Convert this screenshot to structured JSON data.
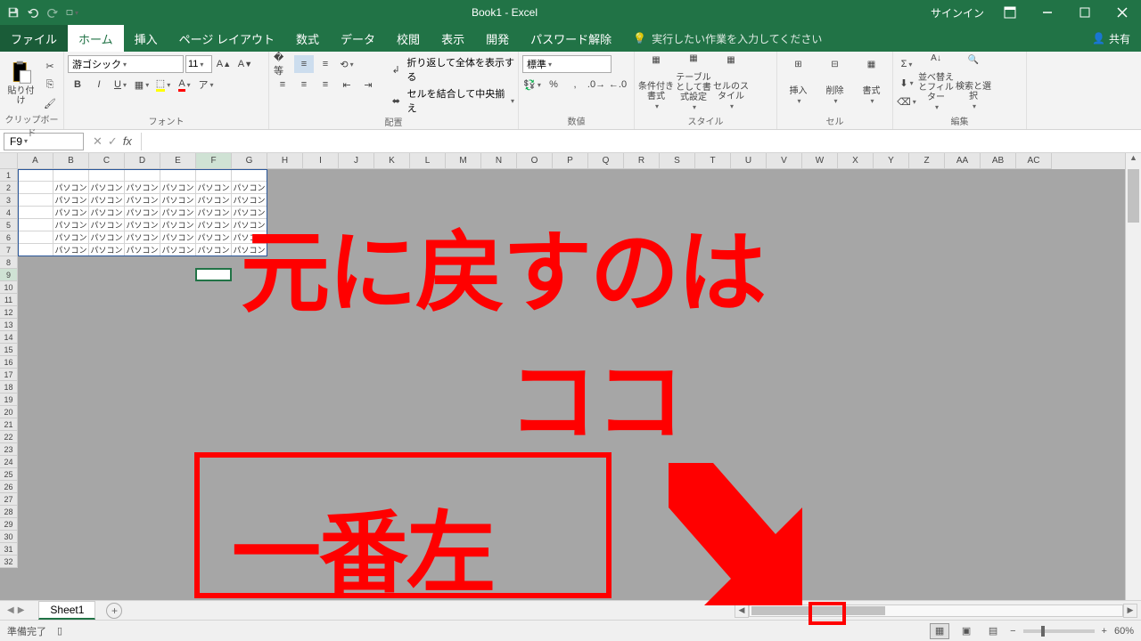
{
  "title": "Book1 - Excel",
  "signin": "サインイン",
  "share": "共有",
  "tabs": {
    "file": "ファイル",
    "home": "ホーム",
    "insert": "挿入",
    "layout": "ページ レイアウト",
    "formulas": "数式",
    "data": "データ",
    "review": "校閲",
    "view": "表示",
    "dev": "開発",
    "pwd": "パスワード解除"
  },
  "tellme": "実行したい作業を入力してください",
  "ribbon": {
    "clipboard": {
      "label": "クリップボード",
      "paste": "貼り付け"
    },
    "font": {
      "label": "フォント",
      "name": "游ゴシック",
      "size": "11"
    },
    "align": {
      "label": "配置",
      "wrap": "折り返して全体を表示する",
      "merge": "セルを結合して中央揃え"
    },
    "number": {
      "label": "数値",
      "format": "標準"
    },
    "styles": {
      "label": "スタイル",
      "cond": "条件付き書式",
      "table": "テーブルとして書式設定",
      "cell": "セルのスタイル"
    },
    "cells": {
      "label": "セル",
      "insert": "挿入",
      "delete": "削除",
      "format": "書式"
    },
    "editing": {
      "label": "編集",
      "sort": "並べ替えとフィルター",
      "find": "検索と選択"
    }
  },
  "namebox": "F9",
  "columns": [
    "A",
    "B",
    "C",
    "D",
    "E",
    "F",
    "G",
    "H",
    "I",
    "J",
    "K",
    "L",
    "M",
    "N",
    "O",
    "P",
    "Q",
    "R",
    "S",
    "T",
    "U",
    "V",
    "W",
    "X",
    "Y",
    "Z",
    "AA",
    "AB",
    "AC"
  ],
  "rows": [
    1,
    2,
    3,
    4,
    5,
    6,
    7,
    8,
    9,
    10,
    11,
    12,
    13,
    14,
    15,
    16,
    17,
    18,
    19,
    20,
    21,
    22,
    23,
    24,
    25,
    26,
    27,
    28,
    29,
    30,
    31,
    32
  ],
  "celltext": "パソコン",
  "sheet": "Sheet1",
  "status": "準備完了",
  "zoom": "60%",
  "anno": {
    "l1": "元に戻すのは",
    "l2": "ココ",
    "l3": "一番左"
  }
}
